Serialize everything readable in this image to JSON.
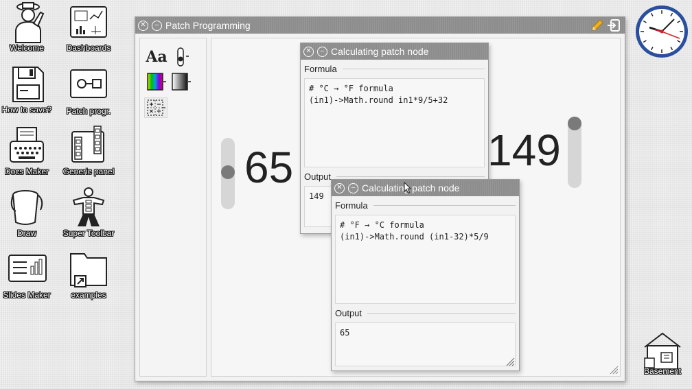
{
  "desktop": {
    "icons": [
      {
        "label": "Welcome",
        "icon": "person-hat-icon"
      },
      {
        "label": "Dashboards",
        "icon": "dashboard-icon"
      },
      {
        "label": "How to save?",
        "icon": "floppy-disk-icon"
      },
      {
        "label": "Patch progr.",
        "icon": "patch-icon"
      },
      {
        "label": "Docs Maker",
        "icon": "typewriter-icon"
      },
      {
        "label": "Generic panel",
        "icon": "panel-icon"
      },
      {
        "label": "Draw",
        "icon": "paint-bucket-icon"
      },
      {
        "label": "Super Toolbar",
        "icon": "toolbar-figure-icon"
      },
      {
        "label": "Slides Maker",
        "icon": "slides-icon"
      },
      {
        "label": "examples",
        "icon": "folder-shortcut-icon"
      }
    ],
    "basement_label": "Basement"
  },
  "main_window": {
    "title": "Patch Programming",
    "close_glyph": "✕",
    "minimize_glyph": "–",
    "palette": {
      "text_tool_label": "Aa"
    },
    "celsius_value": "65",
    "fahrenheit_value": "149",
    "left_slider_level": 0.52,
    "right_slider_level": 1.0
  },
  "node1": {
    "title": "Calculating patch node",
    "formula_label": "Formula",
    "formula_code": "# °C → °F formula\n(in1)->Math.round in1*9/5+32",
    "output_label": "Output",
    "output_value": "149"
  },
  "node2": {
    "title": "Calculating patch node",
    "formula_label": "Formula",
    "formula_code": "# °F → °C formula\n(in1)->Math.round (in1-32)*5/9",
    "output_label": "Output",
    "output_value": "65"
  },
  "colors": {
    "titlebar": "#8d8d8d",
    "clock_rim": "#2a4f9e",
    "clock_hand": "#d42020",
    "edit_pencil": "#f0b020"
  }
}
